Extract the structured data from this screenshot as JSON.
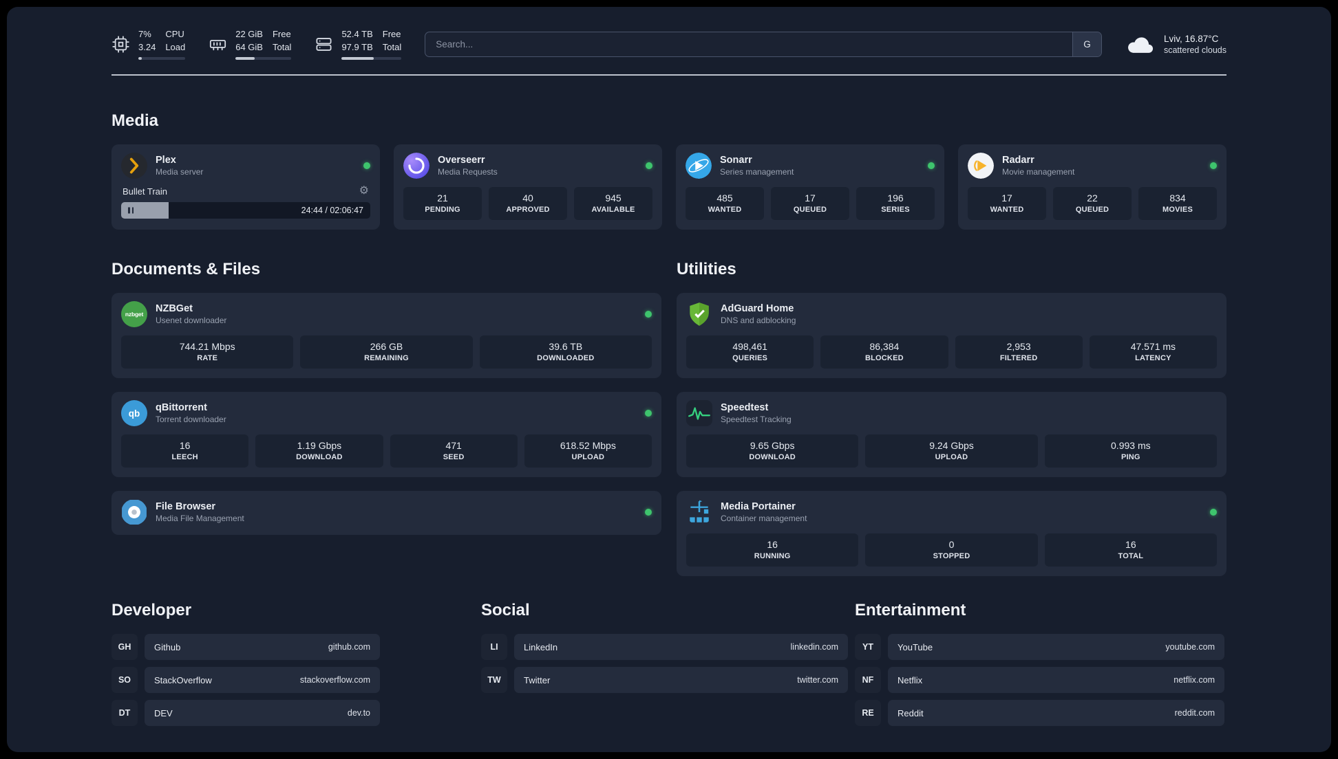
{
  "topbar": {
    "cpu": {
      "value_top": "7%",
      "value_bottom": "3.24",
      "label_top": "CPU",
      "label_bottom": "Load",
      "progress": 7
    },
    "ram": {
      "value_top": "22 GiB",
      "value_bottom": "64 GiB",
      "label_top": "Free",
      "label_bottom": "Total",
      "progress": 34
    },
    "disk": {
      "value_top": "52.4 TB",
      "value_bottom": "97.9 TB",
      "label_top": "Free",
      "label_bottom": "Total",
      "progress": 54
    },
    "search": {
      "placeholder": "Search...",
      "button_label": "G"
    },
    "weather": {
      "location": "Lviv, 16.87°C",
      "condition": "scattered clouds"
    }
  },
  "media": {
    "title": "Media",
    "plex": {
      "name": "Plex",
      "subtitle": "Media server",
      "now_playing": "Bullet Train",
      "time": "24:44 / 02:06:47",
      "progress": 19
    },
    "overseerr": {
      "name": "Overseerr",
      "subtitle": "Media Requests",
      "stats": [
        {
          "value": "21",
          "label": "PENDING"
        },
        {
          "value": "40",
          "label": "APPROVED"
        },
        {
          "value": "945",
          "label": "AVAILABLE"
        }
      ]
    },
    "sonarr": {
      "name": "Sonarr",
      "subtitle": "Series management",
      "stats": [
        {
          "value": "485",
          "label": "WANTED"
        },
        {
          "value": "17",
          "label": "QUEUED"
        },
        {
          "value": "196",
          "label": "SERIES"
        }
      ]
    },
    "radarr": {
      "name": "Radarr",
      "subtitle": "Movie management",
      "stats": [
        {
          "value": "17",
          "label": "WANTED"
        },
        {
          "value": "22",
          "label": "QUEUED"
        },
        {
          "value": "834",
          "label": "MOVIES"
        }
      ]
    }
  },
  "documents": {
    "title": "Documents & Files",
    "nzbget": {
      "name": "NZBGet",
      "subtitle": "Usenet downloader",
      "icon_text": "nzbget",
      "stats": [
        {
          "value": "744.21 Mbps",
          "label": "RATE"
        },
        {
          "value": "266 GB",
          "label": "REMAINING"
        },
        {
          "value": "39.6 TB",
          "label": "DOWNLOADED"
        }
      ]
    },
    "qbittorrent": {
      "name": "qBittorrent",
      "subtitle": "Torrent downloader",
      "icon_text": "qb",
      "stats": [
        {
          "value": "16",
          "label": "LEECH"
        },
        {
          "value": "1.19 Gbps",
          "label": "DOWNLOAD"
        },
        {
          "value": "471",
          "label": "SEED"
        },
        {
          "value": "618.52 Mbps",
          "label": "UPLOAD"
        }
      ]
    },
    "filebrowser": {
      "name": "File Browser",
      "subtitle": "Media File Management"
    }
  },
  "utilities": {
    "title": "Utilities",
    "adguard": {
      "name": "AdGuard Home",
      "subtitle": "DNS and adblocking",
      "stats": [
        {
          "value": "498,461",
          "label": "QUERIES"
        },
        {
          "value": "86,384",
          "label": "BLOCKED"
        },
        {
          "value": "2,953",
          "label": "FILTERED"
        },
        {
          "value": "47.571 ms",
          "label": "LATENCY"
        }
      ]
    },
    "speedtest": {
      "name": "Speedtest",
      "subtitle": "Speedtest Tracking",
      "stats": [
        {
          "value": "9.65 Gbps",
          "label": "DOWNLOAD"
        },
        {
          "value": "9.24 Gbps",
          "label": "UPLOAD"
        },
        {
          "value": "0.993 ms",
          "label": "PING"
        }
      ]
    },
    "portainer": {
      "name": "Media Portainer",
      "subtitle": "Container management",
      "stats": [
        {
          "value": "16",
          "label": "RUNNING"
        },
        {
          "value": "0",
          "label": "STOPPED"
        },
        {
          "value": "16",
          "label": "TOTAL"
        }
      ]
    }
  },
  "bookmarks": {
    "developer": {
      "title": "Developer",
      "items": [
        {
          "abbr": "GH",
          "name": "Github",
          "url": "github.com"
        },
        {
          "abbr": "SO",
          "name": "StackOverflow",
          "url": "stackoverflow.com"
        },
        {
          "abbr": "DT",
          "name": "DEV",
          "url": "dev.to"
        }
      ]
    },
    "social": {
      "title": "Social",
      "items": [
        {
          "abbr": "LI",
          "name": "LinkedIn",
          "url": "linkedin.com"
        },
        {
          "abbr": "TW",
          "name": "Twitter",
          "url": "twitter.com"
        }
      ]
    },
    "entertainment": {
      "title": "Entertainment",
      "items": [
        {
          "abbr": "YT",
          "name": "YouTube",
          "url": "youtube.com"
        },
        {
          "abbr": "NF",
          "name": "Netflix",
          "url": "netflix.com"
        },
        {
          "abbr": "RE",
          "name": "Reddit",
          "url": "reddit.com"
        }
      ]
    }
  },
  "colors": {
    "status_online": "#3ec46d",
    "plex_amber": "#e5a00d",
    "adguard_green": "#68b738",
    "portainer_blue": "#3da6dd"
  }
}
